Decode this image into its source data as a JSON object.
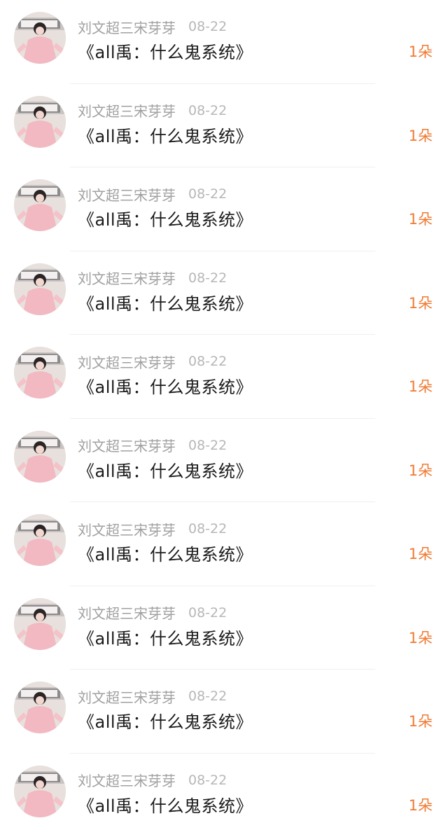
{
  "items": [
    {
      "username": "刘文超三宋芽芽",
      "date": "08-22",
      "title": "《all禹：什么鬼系统》",
      "count": "1朵"
    },
    {
      "username": "刘文超三宋芽芽",
      "date": "08-22",
      "title": "《all禹：什么鬼系统》",
      "count": "1朵"
    },
    {
      "username": "刘文超三宋芽芽",
      "date": "08-22",
      "title": "《all禹：什么鬼系统》",
      "count": "1朵"
    },
    {
      "username": "刘文超三宋芽芽",
      "date": "08-22",
      "title": "《all禹：什么鬼系统》",
      "count": "1朵"
    },
    {
      "username": "刘文超三宋芽芽",
      "date": "08-22",
      "title": "《all禹：什么鬼系统》",
      "count": "1朵"
    },
    {
      "username": "刘文超三宋芽芽",
      "date": "08-22",
      "title": "《all禹：什么鬼系统》",
      "count": "1朵"
    },
    {
      "username": "刘文超三宋芽芽",
      "date": "08-22",
      "title": "《all禹：什么鬼系统》",
      "count": "1朵"
    },
    {
      "username": "刘文超三宋芽芽",
      "date": "08-22",
      "title": "《all禹：什么鬼系统》",
      "count": "1朵"
    },
    {
      "username": "刘文超三宋芽芽",
      "date": "08-22",
      "title": "《all禹：什么鬼系统》",
      "count": "1朵"
    },
    {
      "username": "刘文超三宋芽芽",
      "date": "08-22",
      "title": "《all禹：什么鬼系统》",
      "count": "1朵"
    }
  ],
  "colors": {
    "username": "#a0a0a0",
    "date": "#b7b7b7",
    "title": "#1a1a1a",
    "count_accent": "#f07a33",
    "divider": "#efefef"
  },
  "avatar_icon": "user-avatar-photo"
}
